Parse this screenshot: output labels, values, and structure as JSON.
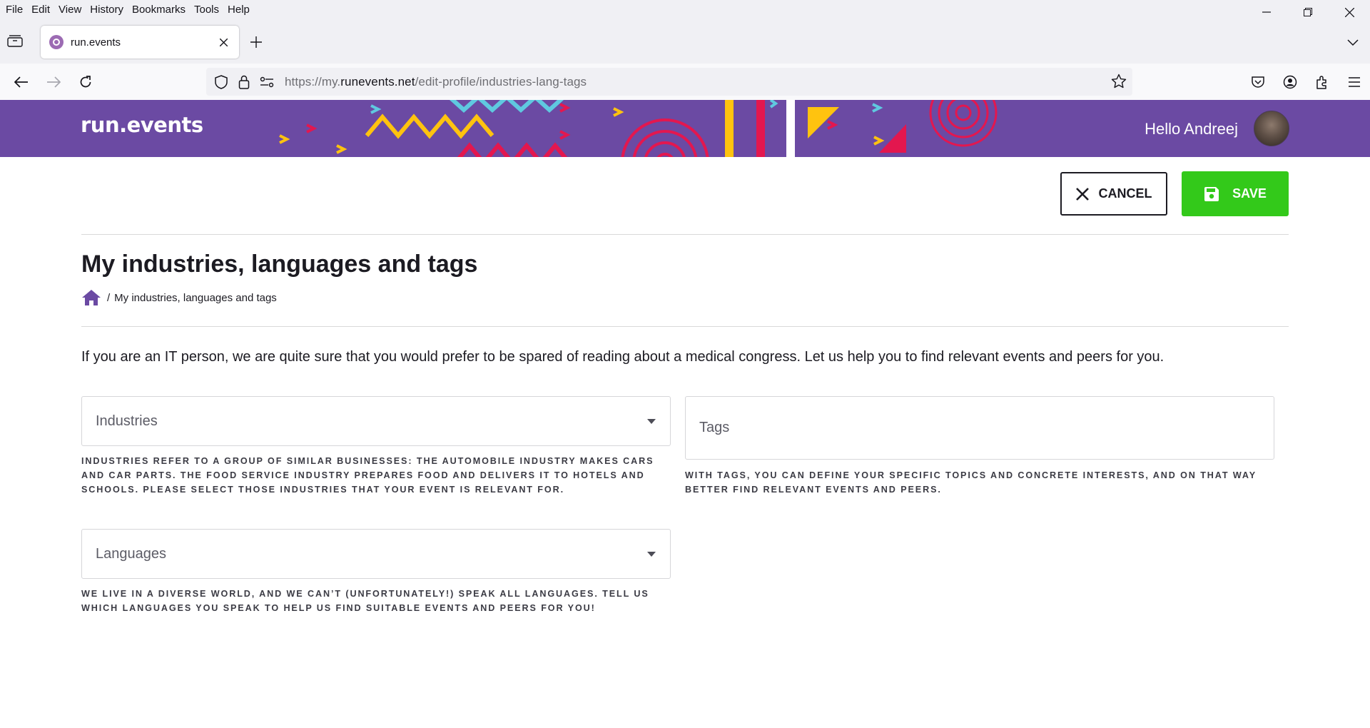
{
  "menu": [
    "File",
    "Edit",
    "View",
    "History",
    "Bookmarks",
    "Tools",
    "Help"
  ],
  "tab": {
    "title": "run.events"
  },
  "url": {
    "prefix": "https://my.",
    "domain": "runevents.net",
    "path": "/edit-profile/industries-lang-tags"
  },
  "site": {
    "logo": "run.events",
    "greeting": "Hello Andreej",
    "brand_color": "#6b4aa3"
  },
  "actions": {
    "cancel_label": "CANCEL",
    "save_label": "SAVE",
    "save_color": "#33c91a"
  },
  "page": {
    "title": "My industries, languages and tags",
    "breadcrumb_current": "My industries, languages and tags",
    "breadcrumb_sep": "/",
    "intro": "If you are an IT person, we are quite sure that you would prefer to be spared of reading about a medical congress. Let us help you to find relevant events and peers for you."
  },
  "fields": {
    "industries": {
      "label": "Industries",
      "hint": "Industries refer to a group of similar businesses: the automobile industry makes cars and car parts. The food service industry prepares food and delivers it to hotels and schools. Please select those industries that your event is relevant for."
    },
    "tags": {
      "label": "Tags",
      "hint": "With tags, you can define your specific topics and concrete interests, and on that way better find relevant events and peers."
    },
    "languages": {
      "label": "Languages",
      "hint": "We live in a diverse world, and we can’t (unfortunately!) speak all languages. Tell us which languages you speak to help us find suitable events and peers for you!"
    }
  }
}
